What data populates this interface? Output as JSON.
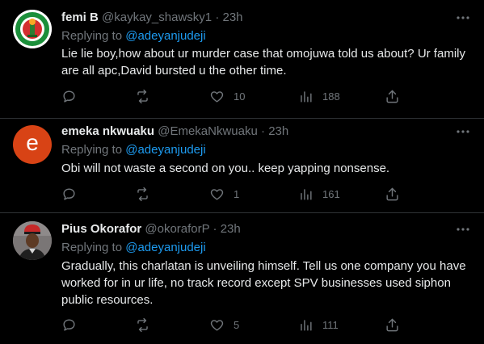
{
  "tweets": [
    {
      "name": "femi B",
      "handle": "@kaykay_shawsky1",
      "sep": "·",
      "time": "23h",
      "replying_prefix": "Replying to ",
      "replying_to": "@adeyanjudeji",
      "text": "Lie lie boy,how about ur murder case that omojuwa told us about? Ur family are all apc,David bursted u the other time.",
      "likes": "10",
      "views": "188",
      "avatar": "party-logo"
    },
    {
      "name": "emeka nkwuaku",
      "handle": "@EmekaNkwuaku",
      "sep": "·",
      "time": "23h",
      "replying_prefix": "Replying to ",
      "replying_to": "@adeyanjudeji",
      "text": "Obi will not waste a second on you.. keep yapping nonsense.",
      "likes": "1",
      "views": "161",
      "avatar_letter": "e",
      "avatar_color": "#d84315"
    },
    {
      "name": "Pius Okorafor",
      "handle": "@okoraforP",
      "sep": "·",
      "time": "23h",
      "replying_prefix": "Replying to ",
      "replying_to": "@adeyanjudeji",
      "text": "Gradually, this charlatan is unveiling himself. Tell us one company you have worked for in ur life, no track record except SPV businesses used siphon public resources.",
      "likes": "5",
      "views": "111",
      "avatar": "person-photo"
    }
  ],
  "colors": {
    "background": "#000000",
    "text": "#e7e9ea",
    "muted": "#71767b",
    "link": "#1d9bf0",
    "divider": "#2f3336"
  }
}
